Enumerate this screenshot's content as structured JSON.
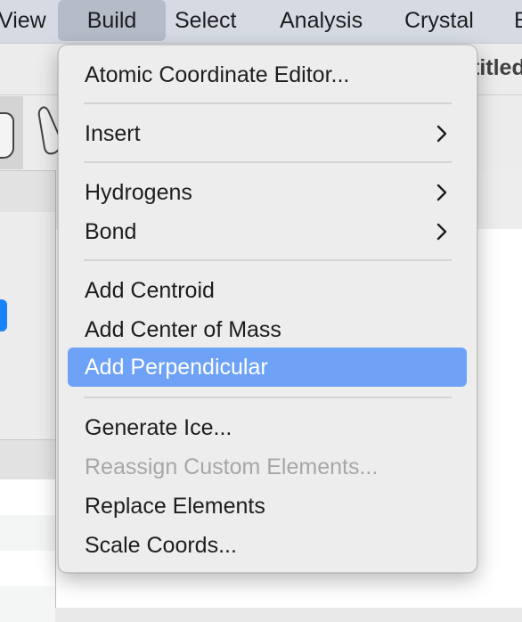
{
  "menubar": {
    "items": [
      "View",
      "Build",
      "Select",
      "Analysis",
      "Crystal",
      "E"
    ],
    "active_index": 1
  },
  "window": {
    "title_fragment": "titled"
  },
  "icons": {
    "hand": "hand-tool-icon",
    "pointer": "pointer-tool-icon",
    "submenu": "chevron-right-icon"
  },
  "colors": {
    "highlight": "#6ea2f7",
    "accent_control": "#1a82fb",
    "menubar_active": "#b4bcc8"
  },
  "menu": {
    "title": "Build",
    "items": [
      {
        "label": "Atomic Coordinate Editor...",
        "submenu": false,
        "enabled": true,
        "selected": false
      },
      {
        "label": "Insert",
        "submenu": true,
        "enabled": true,
        "selected": false
      },
      {
        "label": "Hydrogens",
        "submenu": true,
        "enabled": true,
        "selected": false
      },
      {
        "label": "Bond",
        "submenu": true,
        "enabled": true,
        "selected": false
      },
      {
        "label": "Add Centroid",
        "submenu": false,
        "enabled": true,
        "selected": false
      },
      {
        "label": "Add Center of Mass",
        "submenu": false,
        "enabled": true,
        "selected": false
      },
      {
        "label": "Add Perpendicular",
        "submenu": false,
        "enabled": true,
        "selected": true
      },
      {
        "label": "Generate Ice...",
        "submenu": false,
        "enabled": true,
        "selected": false
      },
      {
        "label": "Reassign Custom Elements...",
        "submenu": false,
        "enabled": false,
        "selected": false
      },
      {
        "label": "Replace Elements",
        "submenu": false,
        "enabled": true,
        "selected": false
      },
      {
        "label": "Scale Coords...",
        "submenu": false,
        "enabled": true,
        "selected": false
      }
    ]
  }
}
